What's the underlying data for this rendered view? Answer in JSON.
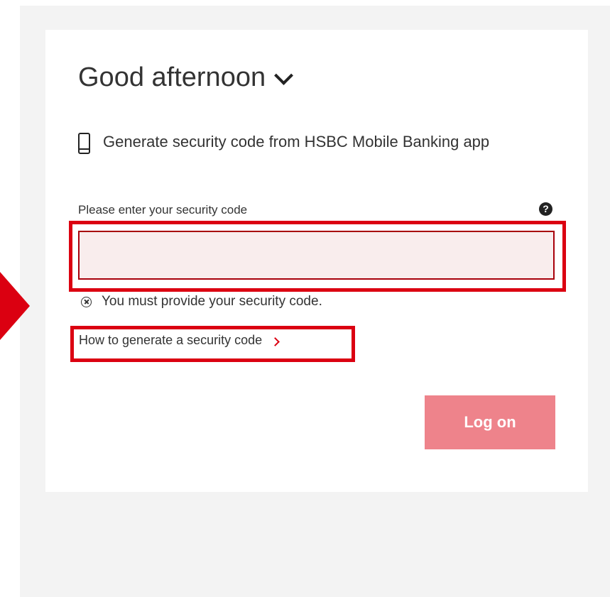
{
  "greeting": {
    "text": "Good afternoon"
  },
  "method": {
    "text": "Generate security code from HSBC Mobile Banking app"
  },
  "security_field": {
    "label": "Please enter your security code",
    "value": "",
    "help_symbol": "?"
  },
  "error": {
    "message": "You must provide your security code."
  },
  "help_link": {
    "text": "How to generate a security code"
  },
  "actions": {
    "logon_label": "Log on"
  },
  "colors": {
    "brand_red": "#db0011",
    "button_disabled": "#ee838b",
    "input_error_bg": "#f9eded"
  },
  "icons": {
    "greeting_toggle": "chevron-down-icon",
    "method": "mobile-phone-icon",
    "help": "question-circle-icon",
    "error": "error-circle-x-icon",
    "link": "chevron-right-icon",
    "pointer": "red-arrow-pointer"
  }
}
